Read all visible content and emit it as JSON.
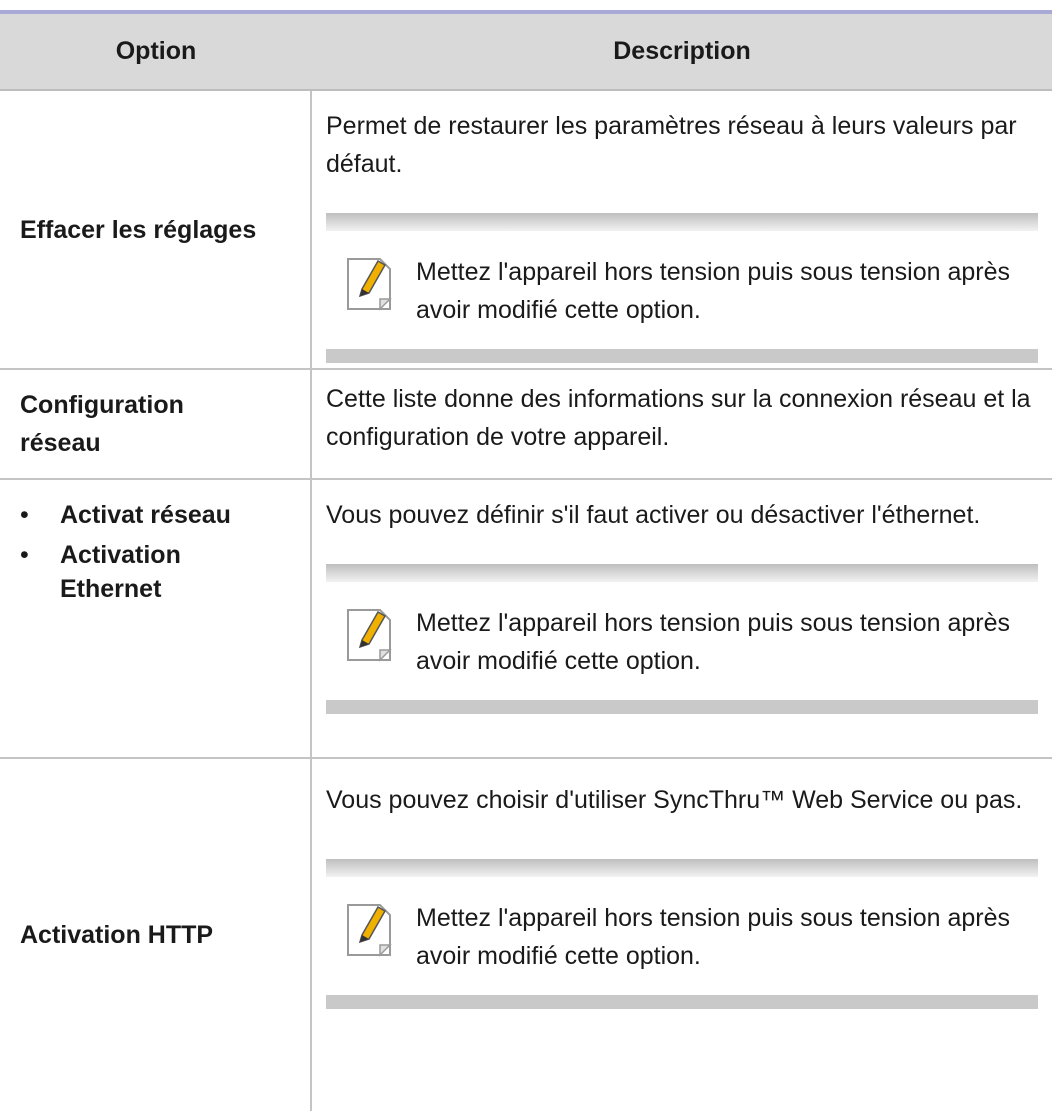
{
  "header": {
    "option": "Option",
    "description": "Description"
  },
  "rows": [
    {
      "option": "Effacer les réglages",
      "description": "Permet de restaurer les paramètres réseau à leurs valeurs par défaut.",
      "note": "Mettez l'appareil hors tension puis sous tension après avoir modifié cette option."
    },
    {
      "option": "Configuration réseau",
      "description": "Cette liste donne des informations sur la connexion réseau et la configuration de votre appareil."
    },
    {
      "options": [
        "Activat réseau",
        "Activation Ethernet"
      ],
      "description": "Vous pouvez définir s'il faut activer ou désactiver l'éthernet.",
      "note": "Mettez l'appareil hors tension puis sous tension après avoir modifié cette option."
    },
    {
      "option": "Activation HTTP",
      "description": "Vous pouvez choisir d'utiliser SyncThru™ Web Service ou pas.",
      "note": "Mettez l'appareil hors tension puis sous tension après avoir modifié cette option."
    }
  ],
  "icons": {
    "note": "note-pencil-icon",
    "bullet": "•"
  },
  "colors": {
    "header_bg": "#d9d9d9",
    "top_rule": "#a9a9d6",
    "note_bar": "#c9c9c9",
    "pencil": "#f0b000"
  }
}
